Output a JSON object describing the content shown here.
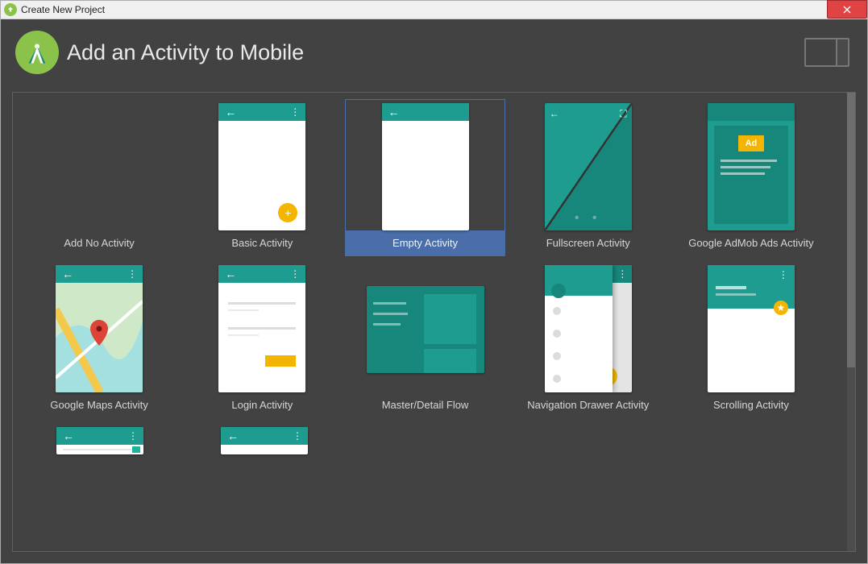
{
  "window": {
    "title": "Create New Project"
  },
  "header": {
    "title": "Add an Activity to Mobile"
  },
  "selected_index": 2,
  "templates": {
    "row1": [
      {
        "label": "Add No Activity"
      },
      {
        "label": "Basic Activity"
      },
      {
        "label": "Empty Activity"
      },
      {
        "label": "Fullscreen Activity"
      },
      {
        "label": "Google AdMob Ads Activity",
        "ad_badge": "Ad"
      }
    ],
    "row2": [
      {
        "label": "Google Maps Activity"
      },
      {
        "label": "Login Activity"
      },
      {
        "label": "Master/Detail Flow"
      },
      {
        "label": "Navigation Drawer Activity"
      },
      {
        "label": "Scrolling Activity"
      }
    ]
  }
}
